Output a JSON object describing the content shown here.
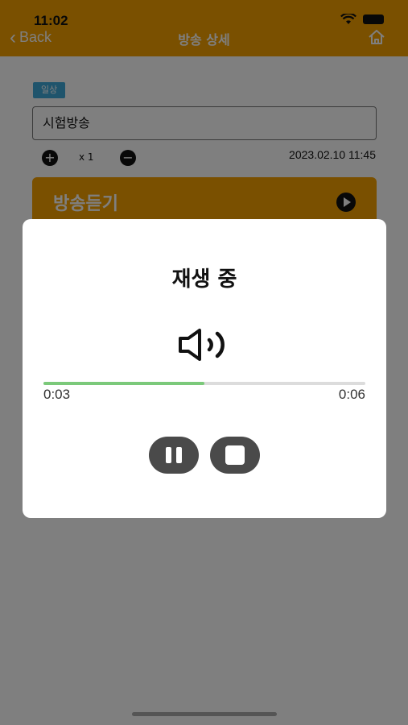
{
  "status_bar": {
    "time": "11:02"
  },
  "header": {
    "back_label": "Back",
    "title": "방송 상세"
  },
  "broadcast": {
    "tag": "일상",
    "name": "시험방송",
    "speed": "x 1",
    "datetime": "2023.02.10 11:45",
    "listen_label": "방송듣기"
  },
  "player": {
    "title": "재생 중",
    "current_time": "0:03",
    "total_time": "0:06",
    "progress": 0.5
  },
  "colors": {
    "accent": "#f4a000",
    "progress": "#7bc97a",
    "tag": "#3fa8d8"
  }
}
